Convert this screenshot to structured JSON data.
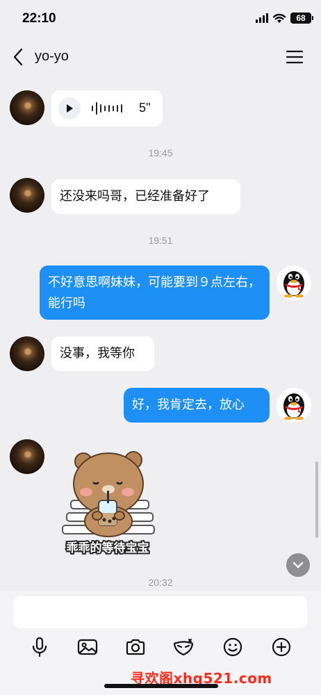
{
  "status_bar": {
    "time": "22:10",
    "battery": "68",
    "icons": [
      "signal-icon",
      "wifi-icon",
      "battery-icon"
    ]
  },
  "header": {
    "title": "yo-yo",
    "back_icon": "chevron-left-icon",
    "menu_icon": "hamburger-menu-icon"
  },
  "messages": [
    {
      "sender": "contact",
      "type": "voice",
      "duration": "5''"
    },
    {
      "type": "timestamp",
      "text": "19:45"
    },
    {
      "sender": "contact",
      "type": "text",
      "text": "还没来吗哥，已经准备好了"
    },
    {
      "type": "timestamp",
      "text": "19:51"
    },
    {
      "sender": "me",
      "type": "text",
      "text": "不好意思啊妹妹，可能要到９点左右，能行吗"
    },
    {
      "sender": "contact",
      "type": "text",
      "text": "没事，我等你"
    },
    {
      "sender": "me",
      "type": "text",
      "text": "好，我肯定去，放心"
    },
    {
      "sender": "contact",
      "type": "sticker",
      "caption": "乖乖的等待宝宝"
    },
    {
      "type": "timestamp",
      "text": "20:32"
    }
  ],
  "input": {
    "placeholder": ""
  },
  "toolbar": [
    "microphone-icon",
    "image-icon",
    "camera-icon",
    "mask-icon",
    "emoji-icon",
    "plus-circle-icon"
  ],
  "watermark": "寻欢阁xhg521.com",
  "colors": {
    "background": "#efeff2",
    "outgoing_bubble": "#1e8ff5",
    "incoming_bubble": "#ffffff",
    "timestamp": "#9a9aa0",
    "watermark": "#ff2a1a"
  }
}
